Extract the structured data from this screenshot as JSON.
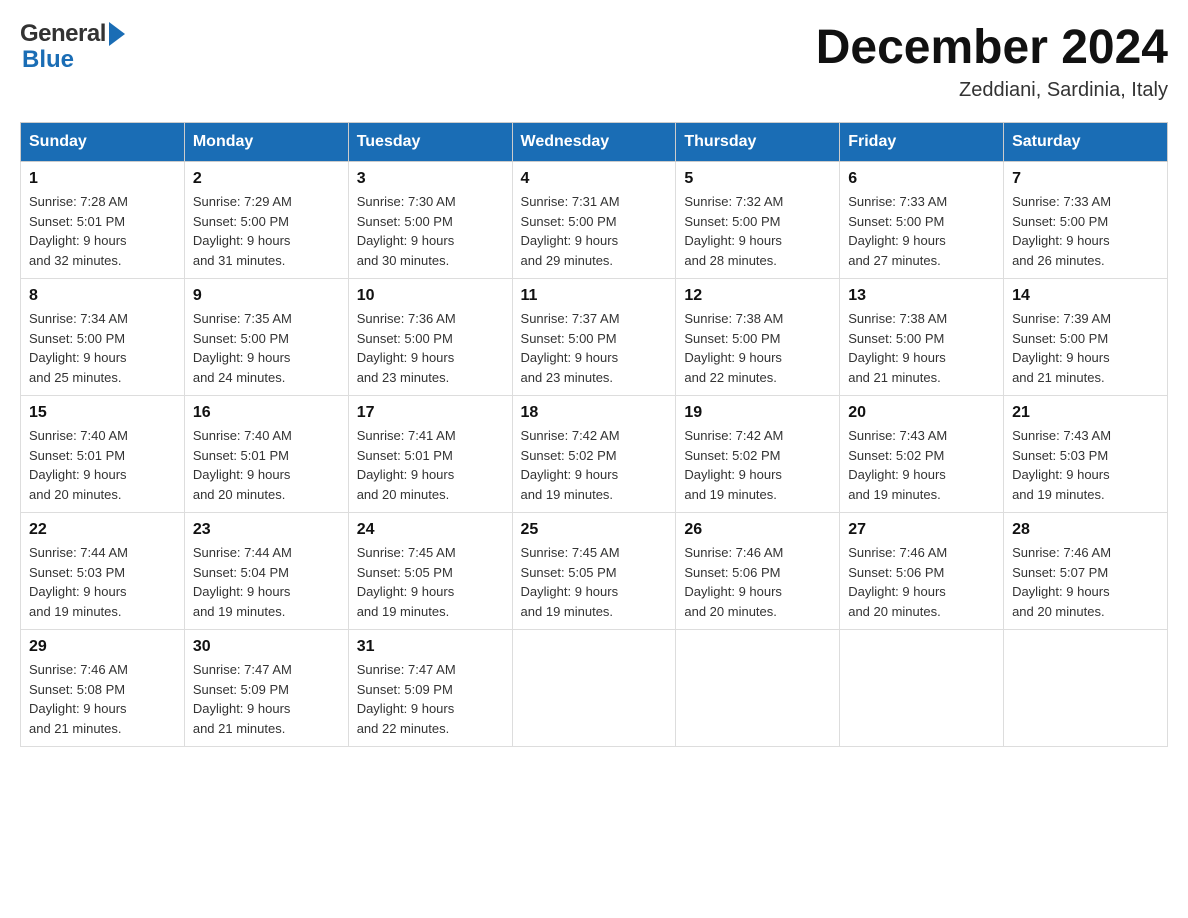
{
  "header": {
    "logo_general": "General",
    "logo_blue": "Blue",
    "month_title": "December 2024",
    "subtitle": "Zeddiani, Sardinia, Italy"
  },
  "days_of_week": [
    "Sunday",
    "Monday",
    "Tuesday",
    "Wednesday",
    "Thursday",
    "Friday",
    "Saturday"
  ],
  "weeks": [
    [
      {
        "day": "1",
        "sunrise": "7:28 AM",
        "sunset": "5:01 PM",
        "daylight": "9 hours and 32 minutes."
      },
      {
        "day": "2",
        "sunrise": "7:29 AM",
        "sunset": "5:00 PM",
        "daylight": "9 hours and 31 minutes."
      },
      {
        "day": "3",
        "sunrise": "7:30 AM",
        "sunset": "5:00 PM",
        "daylight": "9 hours and 30 minutes."
      },
      {
        "day": "4",
        "sunrise": "7:31 AM",
        "sunset": "5:00 PM",
        "daylight": "9 hours and 29 minutes."
      },
      {
        "day": "5",
        "sunrise": "7:32 AM",
        "sunset": "5:00 PM",
        "daylight": "9 hours and 28 minutes."
      },
      {
        "day": "6",
        "sunrise": "7:33 AM",
        "sunset": "5:00 PM",
        "daylight": "9 hours and 27 minutes."
      },
      {
        "day": "7",
        "sunrise": "7:33 AM",
        "sunset": "5:00 PM",
        "daylight": "9 hours and 26 minutes."
      }
    ],
    [
      {
        "day": "8",
        "sunrise": "7:34 AM",
        "sunset": "5:00 PM",
        "daylight": "9 hours and 25 minutes."
      },
      {
        "day": "9",
        "sunrise": "7:35 AM",
        "sunset": "5:00 PM",
        "daylight": "9 hours and 24 minutes."
      },
      {
        "day": "10",
        "sunrise": "7:36 AM",
        "sunset": "5:00 PM",
        "daylight": "9 hours and 23 minutes."
      },
      {
        "day": "11",
        "sunrise": "7:37 AM",
        "sunset": "5:00 PM",
        "daylight": "9 hours and 23 minutes."
      },
      {
        "day": "12",
        "sunrise": "7:38 AM",
        "sunset": "5:00 PM",
        "daylight": "9 hours and 22 minutes."
      },
      {
        "day": "13",
        "sunrise": "7:38 AM",
        "sunset": "5:00 PM",
        "daylight": "9 hours and 21 minutes."
      },
      {
        "day": "14",
        "sunrise": "7:39 AM",
        "sunset": "5:00 PM",
        "daylight": "9 hours and 21 minutes."
      }
    ],
    [
      {
        "day": "15",
        "sunrise": "7:40 AM",
        "sunset": "5:01 PM",
        "daylight": "9 hours and 20 minutes."
      },
      {
        "day": "16",
        "sunrise": "7:40 AM",
        "sunset": "5:01 PM",
        "daylight": "9 hours and 20 minutes."
      },
      {
        "day": "17",
        "sunrise": "7:41 AM",
        "sunset": "5:01 PM",
        "daylight": "9 hours and 20 minutes."
      },
      {
        "day": "18",
        "sunrise": "7:42 AM",
        "sunset": "5:02 PM",
        "daylight": "9 hours and 19 minutes."
      },
      {
        "day": "19",
        "sunrise": "7:42 AM",
        "sunset": "5:02 PM",
        "daylight": "9 hours and 19 minutes."
      },
      {
        "day": "20",
        "sunrise": "7:43 AM",
        "sunset": "5:02 PM",
        "daylight": "9 hours and 19 minutes."
      },
      {
        "day": "21",
        "sunrise": "7:43 AM",
        "sunset": "5:03 PM",
        "daylight": "9 hours and 19 minutes."
      }
    ],
    [
      {
        "day": "22",
        "sunrise": "7:44 AM",
        "sunset": "5:03 PM",
        "daylight": "9 hours and 19 minutes."
      },
      {
        "day": "23",
        "sunrise": "7:44 AM",
        "sunset": "5:04 PM",
        "daylight": "9 hours and 19 minutes."
      },
      {
        "day": "24",
        "sunrise": "7:45 AM",
        "sunset": "5:05 PM",
        "daylight": "9 hours and 19 minutes."
      },
      {
        "day": "25",
        "sunrise": "7:45 AM",
        "sunset": "5:05 PM",
        "daylight": "9 hours and 19 minutes."
      },
      {
        "day": "26",
        "sunrise": "7:46 AM",
        "sunset": "5:06 PM",
        "daylight": "9 hours and 20 minutes."
      },
      {
        "day": "27",
        "sunrise": "7:46 AM",
        "sunset": "5:06 PM",
        "daylight": "9 hours and 20 minutes."
      },
      {
        "day": "28",
        "sunrise": "7:46 AM",
        "sunset": "5:07 PM",
        "daylight": "9 hours and 20 minutes."
      }
    ],
    [
      {
        "day": "29",
        "sunrise": "7:46 AM",
        "sunset": "5:08 PM",
        "daylight": "9 hours and 21 minutes."
      },
      {
        "day": "30",
        "sunrise": "7:47 AM",
        "sunset": "5:09 PM",
        "daylight": "9 hours and 21 minutes."
      },
      {
        "day": "31",
        "sunrise": "7:47 AM",
        "sunset": "5:09 PM",
        "daylight": "9 hours and 22 minutes."
      },
      null,
      null,
      null,
      null
    ]
  ],
  "labels": {
    "sunrise": "Sunrise:",
    "sunset": "Sunset:",
    "daylight": "Daylight:"
  },
  "colors": {
    "header_bg": "#1a6db5",
    "header_text": "#ffffff",
    "border": "#cccccc",
    "logo_blue": "#1a6db5"
  }
}
